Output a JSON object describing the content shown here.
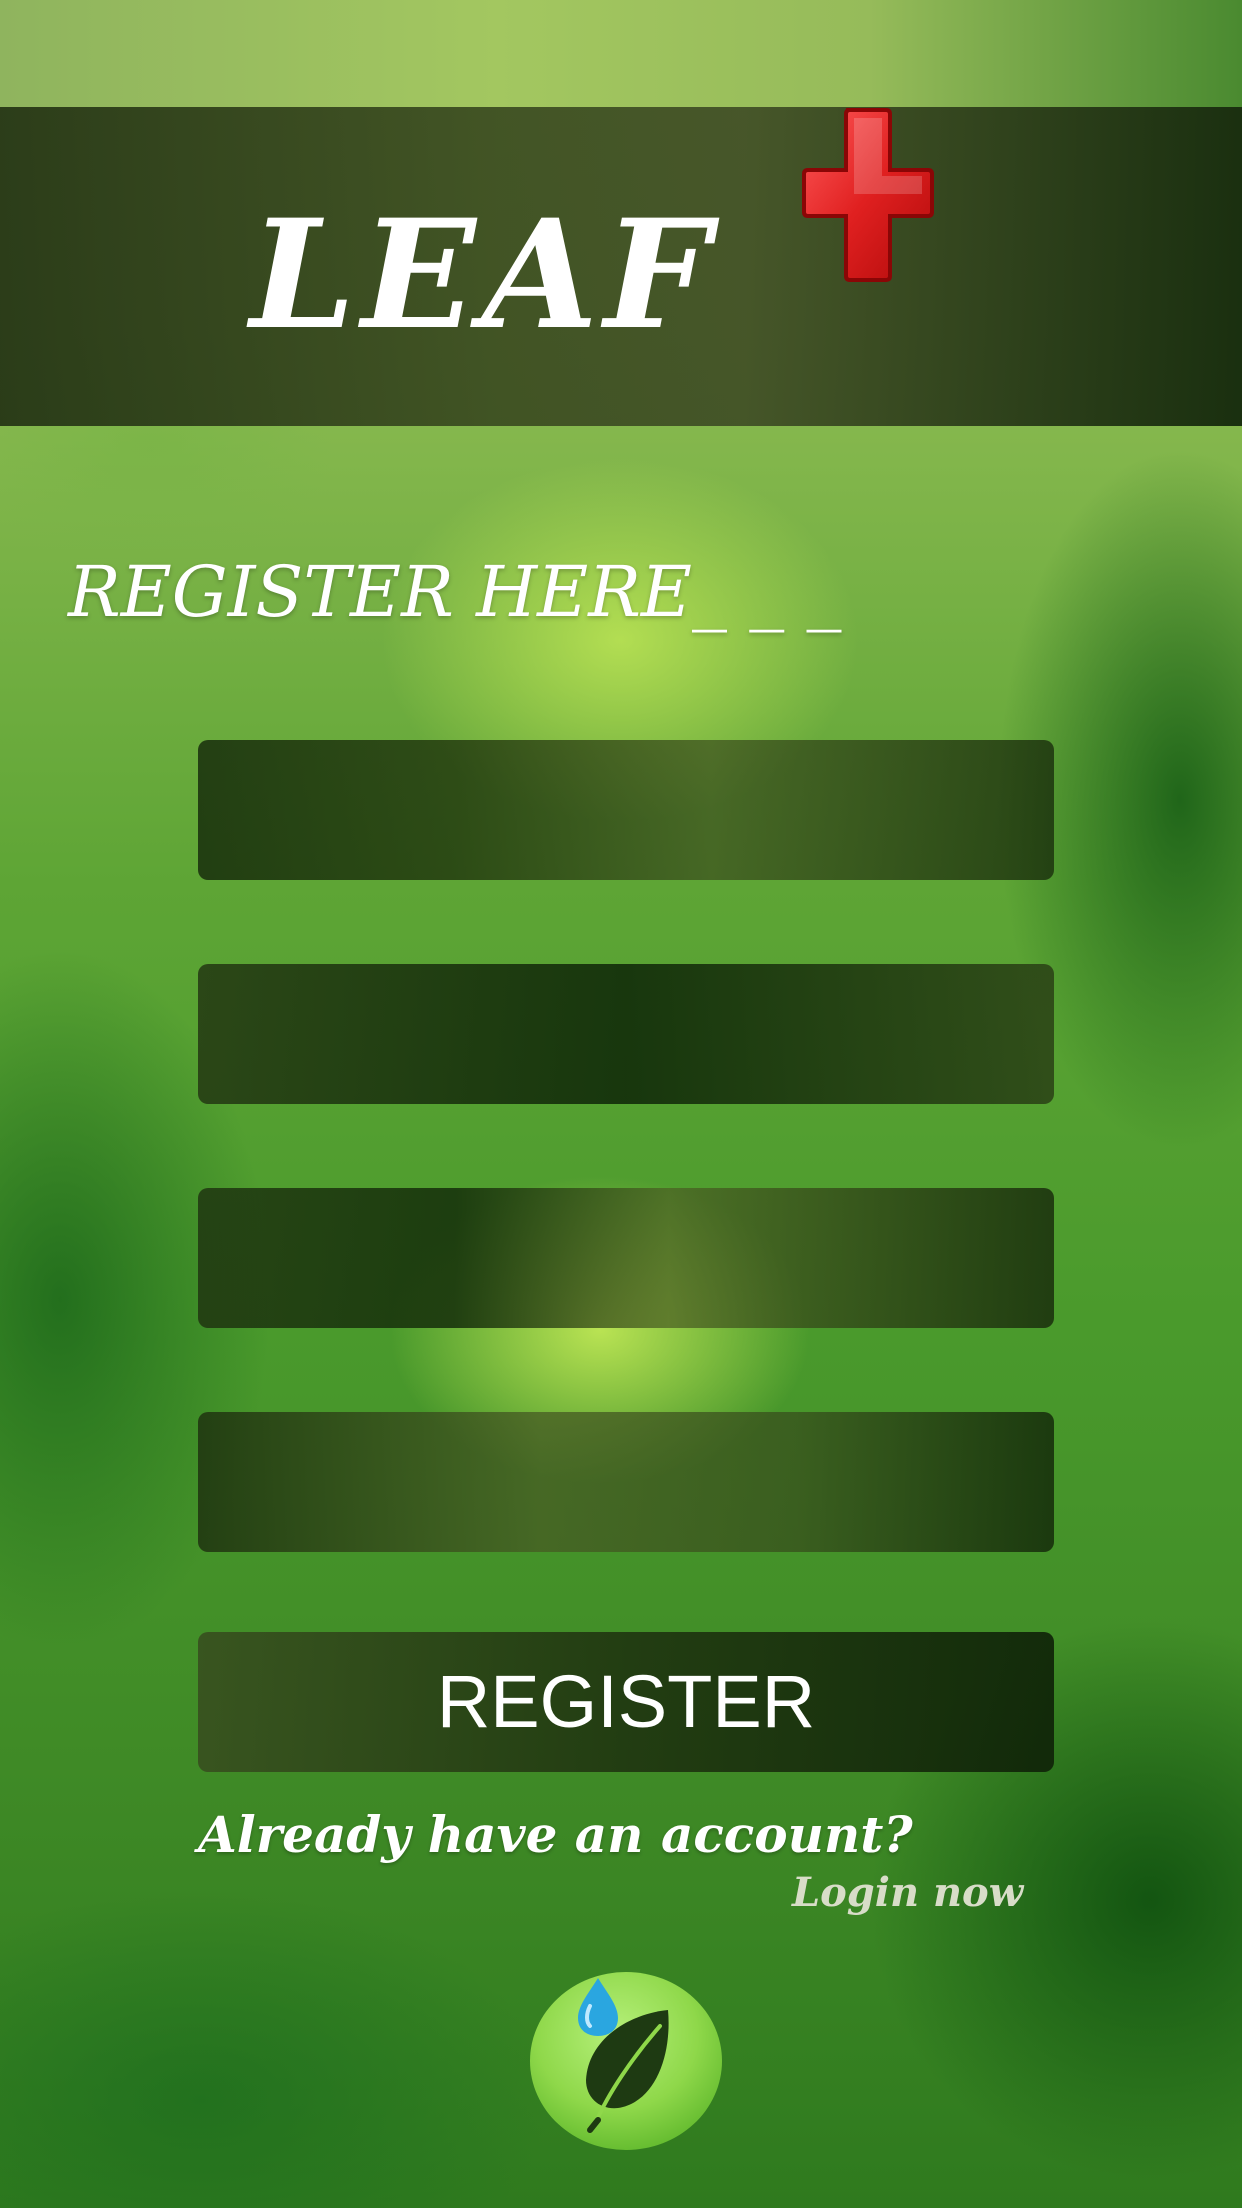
{
  "app": {
    "logo_text": "LEAF",
    "colors": {
      "accent_red": "#d01818",
      "leaf_green": "#8fd84a",
      "water_blue": "#2aa6e0"
    }
  },
  "register": {
    "heading": "REGISTER HERE_ _ _",
    "fields": [
      {
        "value": "",
        "placeholder": ""
      },
      {
        "value": "",
        "placeholder": ""
      },
      {
        "value": "",
        "placeholder": ""
      },
      {
        "value": "",
        "placeholder": ""
      }
    ],
    "button_label": "REGISTER"
  },
  "footer": {
    "account_prompt": "Already have an account?",
    "login_label": "Login now",
    "logo_icon": "leaf-water-drop-icon"
  }
}
